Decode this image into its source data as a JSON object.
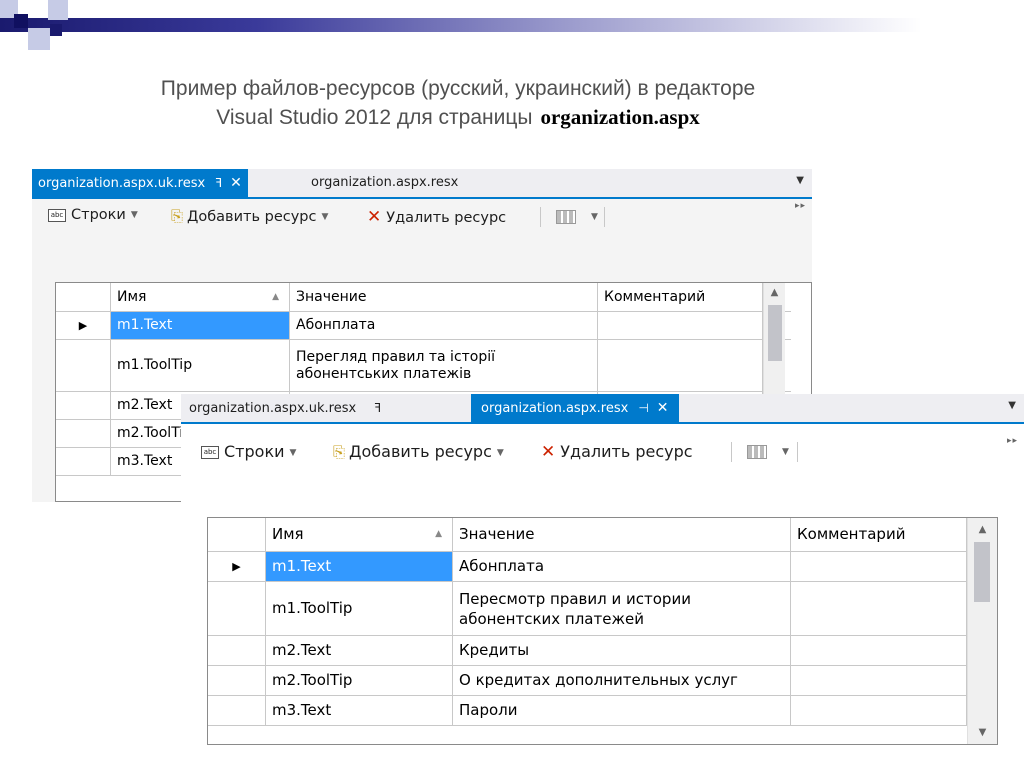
{
  "slide": {
    "title_line1": "Пример файлов-ресурсов (русский, украинский) в редакторе",
    "title_line2": "Visual Studio 2012 для страницы",
    "title_file": "organization.aspx"
  },
  "back_window": {
    "tab_active": "organization.aspx.uk.resx",
    "tab_active_pin": "ꟻ",
    "tab_active_close": "✕",
    "tab_inactive": "organization.aspx.resx",
    "toolbar": {
      "strings": "Строки",
      "add": "Добавить ресурс",
      "delete": "Удалить ресурс"
    },
    "columns": {
      "name": "Имя",
      "value": "Значение",
      "comment": "Комментарий"
    },
    "rows": [
      {
        "marker": "▶",
        "name": "m1.Text",
        "value": "Абонплата",
        "comment": ""
      },
      {
        "marker": "",
        "name": "m1.ToolTip",
        "value": "Перегляд правил та історії\nабонентських платежів",
        "comment": ""
      },
      {
        "marker": "",
        "name": "m2.Text",
        "value": "",
        "comment": ""
      },
      {
        "marker": "",
        "name": "m2.ToolTip",
        "value": "",
        "comment": ""
      },
      {
        "marker": "",
        "name": "m3.Text",
        "value": "",
        "comment": ""
      }
    ]
  },
  "front_window": {
    "tab_inactive": "organization.aspx.uk.resx",
    "tab_inactive_pin": "ꟻ",
    "tab_active": "organization.aspx.resx",
    "tab_active_pin": "⊣",
    "tab_active_close": "✕",
    "toolbar": {
      "strings": "Строки",
      "add": "Добавить ресурс",
      "delete": "Удалить ресурс"
    },
    "columns": {
      "name": "Имя",
      "value": "Значение",
      "comment": "Комментарий"
    },
    "rows": [
      {
        "marker": "▶",
        "name": "m1.Text",
        "value": "Абонплата",
        "comment": ""
      },
      {
        "marker": "",
        "name": "m1.ToolTip",
        "value": "Пересмотр правил и истории\nабонентских платежей",
        "comment": ""
      },
      {
        "marker": "",
        "name": "m2.Text",
        "value": "Кредиты",
        "comment": ""
      },
      {
        "marker": "",
        "name": "m2.ToolTip",
        "value": "О кредитах дополнительных услуг",
        "comment": ""
      },
      {
        "marker": "",
        "name": "m3.Text",
        "value": "Пароли",
        "comment": ""
      }
    ]
  },
  "colors": {
    "accent": "#007acc",
    "selection": "#3399ff",
    "delete_icon": "#cc2200"
  },
  "icons": {
    "strings": "abc-icon",
    "add": "new-resource-icon",
    "delete": "delete-x-icon",
    "view": "grid-view-icon"
  }
}
